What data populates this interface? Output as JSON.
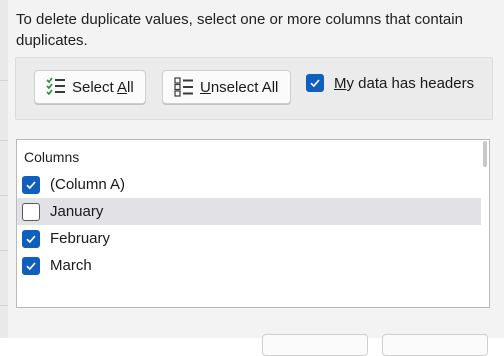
{
  "dialog": {
    "instruction": "To delete duplicate values, select one or more columns that contain duplicates.",
    "select_all": {
      "prefix": "Select ",
      "accel": "A",
      "suffix": "ll",
      "icon": "select-all-icon"
    },
    "unselect_all": {
      "accel": "U",
      "suffix": "nselect All",
      "icon": "unselect-all-icon"
    },
    "headers_option": {
      "accel": "M",
      "suffix": "y data has headers",
      "checked": true
    },
    "columns_title": "Columns",
    "columns": [
      {
        "label": "(Column A)",
        "checked": true
      },
      {
        "label": "January",
        "checked": false
      },
      {
        "label": "February",
        "checked": true
      },
      {
        "label": "March",
        "checked": true
      }
    ]
  },
  "colors": {
    "accent": "#0f5fbf",
    "dialog_bg": "#f3f3f3",
    "highlight_row": "#e2e2e6"
  }
}
